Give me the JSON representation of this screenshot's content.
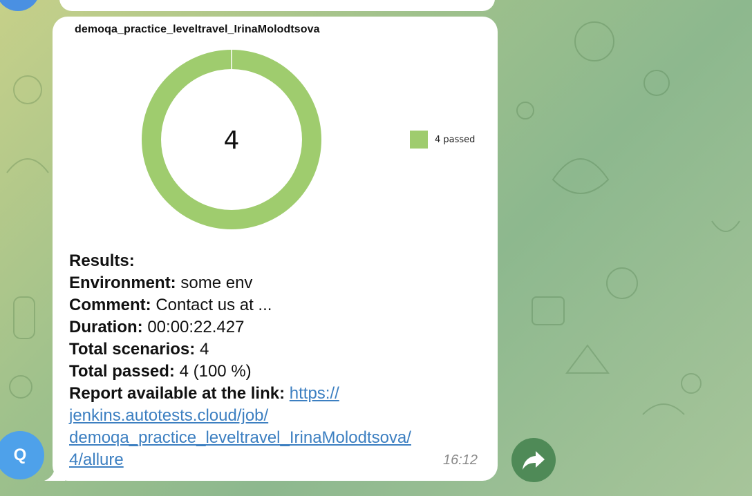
{
  "chat": {
    "avatar_letter": "Q",
    "forward_icon": "share-arrow-icon"
  },
  "report": {
    "title": "demoqa_practice_leveltravel_IrinaMolodtsova",
    "passed_count": "4",
    "legend_label": "4 passed",
    "results_label": "Results:",
    "environment_label": "Environment:",
    "environment_value": "some env",
    "comment_label": "Comment:",
    "comment_value": "Contact us at ...",
    "duration_label": "Duration:",
    "duration_value": "00:00:22.427",
    "total_scenarios_label": "Total scenarios:",
    "total_scenarios_value": "4",
    "total_passed_label": "Total passed:",
    "total_passed_value": "4 (100 %)",
    "report_link_label": "Report available at the link:",
    "report_link_line1": "https://",
    "report_link_line2": "jenkins.autotests.cloud/job/",
    "report_link_line3": "demoqa_practice_leveltravel_IrinaMolodtsova/",
    "report_link_line4": "4/allure",
    "timestamp": "16:12"
  },
  "chart_data": {
    "type": "pie",
    "categories": [
      "passed"
    ],
    "values": [
      4
    ],
    "center_label": "4",
    "legend": [
      "4 passed"
    ],
    "colors": [
      "#9fcc6e"
    ]
  },
  "colors": {
    "passed": "#9fcc6e",
    "link": "#3c7fc1",
    "avatar": "#4ea1ea",
    "forward_button": "#4f8a57"
  }
}
